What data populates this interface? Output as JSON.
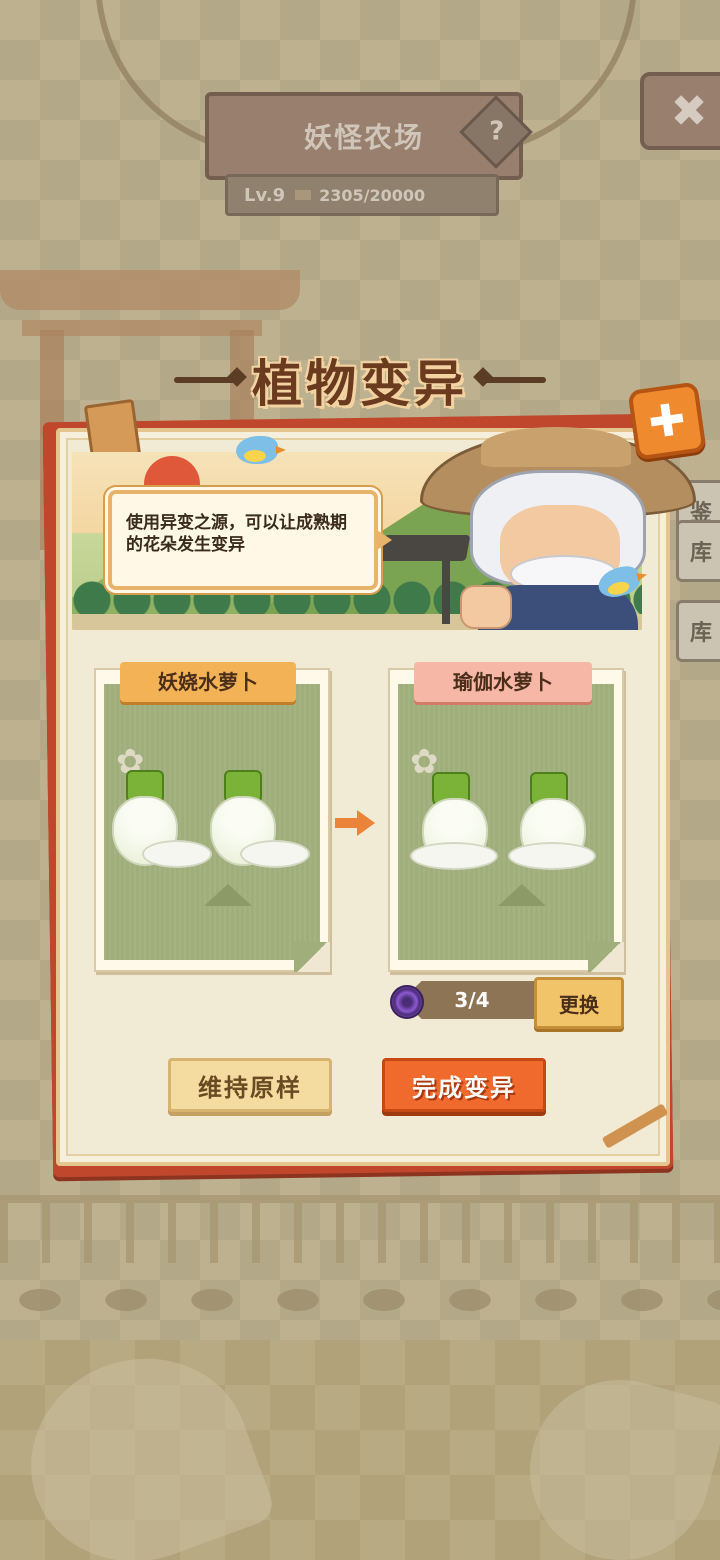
{
  "header": {
    "farm_title": "妖怪农场",
    "help_label": "?",
    "level_label": "Lv.9",
    "xp_text": "2305/20000",
    "close_label": "✖"
  },
  "side_tabs": [
    "鉴",
    "库",
    "库"
  ],
  "dialog": {
    "title": "植物变异",
    "close_label": "✚",
    "speech": "使用异变之源，可以让成熟期的花朵发生变异",
    "source_card": {
      "label": "妖娆水萝卜"
    },
    "result_card": {
      "label": "瑜伽水萝卜"
    },
    "mutation_counter": "3/4",
    "change_button": "更换",
    "keep_button": "维持原样",
    "complete_button": "完成变异"
  },
  "colors": {
    "accent_orange": "#f06a2e",
    "frame_red": "#c0472c",
    "paper": "#f1ead5"
  }
}
